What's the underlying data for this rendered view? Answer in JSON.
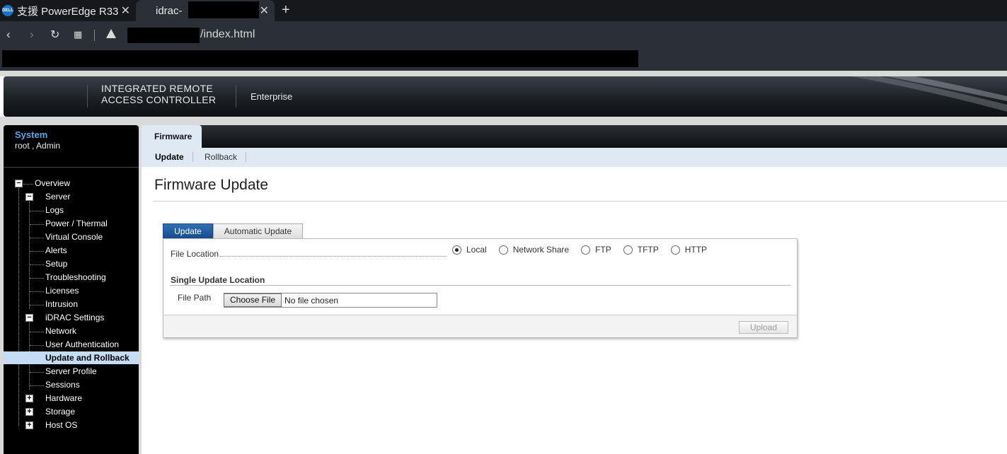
{
  "browser": {
    "tabs": [
      {
        "title": "支援 PowerEdge R33",
        "active": false
      },
      {
        "title": "idrac-",
        "active": true
      }
    ],
    "url_suffix": "/index.html"
  },
  "header": {
    "brand_line1": "INTEGRATED REMOTE",
    "brand_line2": "ACCESS CONTROLLER",
    "edition": "Enterprise"
  },
  "sidebar": {
    "system": "System",
    "user": "root , Admin",
    "tree": [
      {
        "label": "Overview",
        "toggle": "−"
      },
      {
        "label": "Server",
        "toggle": "−"
      },
      {
        "label": "Logs"
      },
      {
        "label": "Power / Thermal"
      },
      {
        "label": "Virtual Console"
      },
      {
        "label": "Alerts"
      },
      {
        "label": "Setup"
      },
      {
        "label": "Troubleshooting"
      },
      {
        "label": "Licenses"
      },
      {
        "label": "Intrusion"
      },
      {
        "label": "iDRAC Settings",
        "toggle": "−"
      },
      {
        "label": "Network"
      },
      {
        "label": "User Authentication"
      },
      {
        "label": "Update and Rollback",
        "selected": true
      },
      {
        "label": "Server Profile"
      },
      {
        "label": "Sessions"
      },
      {
        "label": "Hardware",
        "toggle": "+"
      },
      {
        "label": "Storage",
        "toggle": "+"
      },
      {
        "label": "Host OS",
        "toggle": "+"
      }
    ]
  },
  "main": {
    "tab": "Firmware",
    "subtabs": [
      {
        "label": "Update",
        "active": true
      },
      {
        "label": "Rollback",
        "active": false
      }
    ],
    "title": "Firmware Update",
    "inner_tabs": [
      {
        "label": "Update",
        "active": true
      },
      {
        "label": "Automatic Update",
        "active": false
      }
    ],
    "file_location_label": "File Location",
    "file_location_options": [
      {
        "label": "Local",
        "checked": true
      },
      {
        "label": "Network Share",
        "checked": false
      },
      {
        "label": "FTP",
        "checked": false
      },
      {
        "label": "TFTP",
        "checked": false
      },
      {
        "label": "HTTP",
        "checked": false
      }
    ],
    "single_update_heading": "Single Update Location",
    "file_path_label": "File Path",
    "choose_file_label": "Choose File",
    "no_file_text": "No file chosen",
    "upload_label": "Upload"
  }
}
